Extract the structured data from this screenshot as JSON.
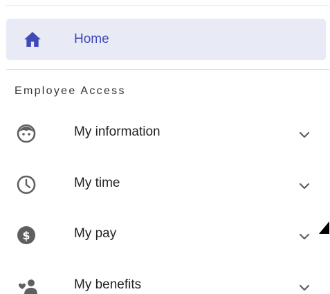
{
  "nav": {
    "home": {
      "label": "Home",
      "icon": "home-icon"
    },
    "section_title": "Employee Access",
    "items": [
      {
        "label": "My information",
        "icon": "face-icon"
      },
      {
        "label": "My time",
        "icon": "clock-icon"
      },
      {
        "label": "My pay",
        "icon": "dollar-coin-icon"
      },
      {
        "label": "My benefits",
        "icon": "people-heart-icon"
      }
    ]
  },
  "colors": {
    "accent": "#3f4ab5",
    "home_background": "#e8eaf6",
    "icon": "#5f5f5f"
  }
}
